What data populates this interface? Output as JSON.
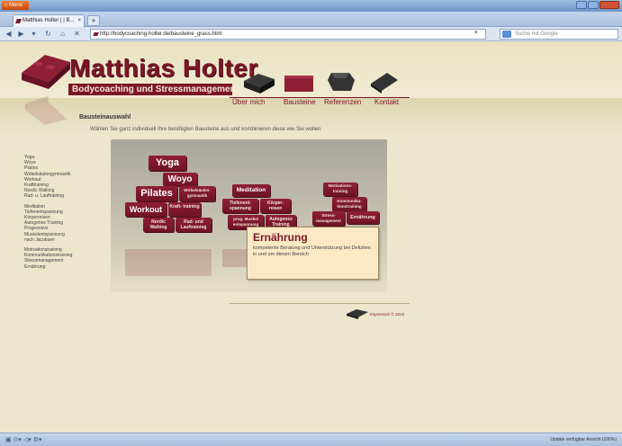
{
  "browser": {
    "app_button": "Menü",
    "tab_title": "Matthias Holter | | B...",
    "tab_close": "×",
    "new_tab": "+",
    "url": "http://bodycoaching-holter.de/bausteine_grass.html",
    "search_placeholder": "Suche mit Google",
    "status_right": "Update verfügbar   Ansicht (100%)"
  },
  "site": {
    "title": "Matthias Holter",
    "subtitle": "Bodycoaching und Stressmanagement",
    "nav": [
      "Über mich",
      "Bausteine",
      "Referenzen",
      "Kontakt"
    ],
    "page_heading": "Bausteinauswahl",
    "intro": "Wählen Sie ganz individuell Ihre benötigten Bausteine aus und kombinieren diese wie Sie wollen",
    "sidebar_groups": [
      [
        "Yoga",
        "Woyo",
        "Pilates",
        "Wirbelsäulengymnastik",
        "Workout",
        "Krafttraining",
        "Nordic Walking",
        "Rad- u. Lauftraining"
      ],
      [
        "Meditation",
        "Tiefenentspannung",
        "Körperreisen",
        "Autogenes Training",
        "Progressive",
        "Muskelentspannung",
        "nach Jacobsen"
      ],
      [
        "Motivationstraining",
        "Kommunikationstraining",
        "Stressmanagement",
        "Ernährung"
      ]
    ],
    "blocks": {
      "yoga": "Yoga",
      "woyo": "Woyo",
      "pilates": "Pilates",
      "wirbel": "Wirbelsäulen- gymnastik",
      "workout": "Workout",
      "kraft": "Kraft- training",
      "nordic": "Nordic Walking",
      "rad": "Rad- und Lauftraining",
      "meditation": "Meditation",
      "tiefen": "Tiefenent- spannung",
      "koerper": "Körper- reisen",
      "progmuskel": "prog. Muskel entspannung",
      "autogenes": "Autogenes Training",
      "motivation": "Motivations- training",
      "kommunikation": "Kommunika- tionstraining",
      "stress": "Stress- management",
      "ernaehrung": "Ernährung"
    },
    "info_title": "Ernährung",
    "info_text": "kompetente Beratung und Unterstützung bei Defiziten in und um diesen Bereich",
    "footer": "Impressum © 2010"
  },
  "colors": {
    "brand": "#7b1628",
    "page_bg": "#ebe6cc",
    "info_bg": "#fbe9c6",
    "chrome": "#a9c0de"
  }
}
